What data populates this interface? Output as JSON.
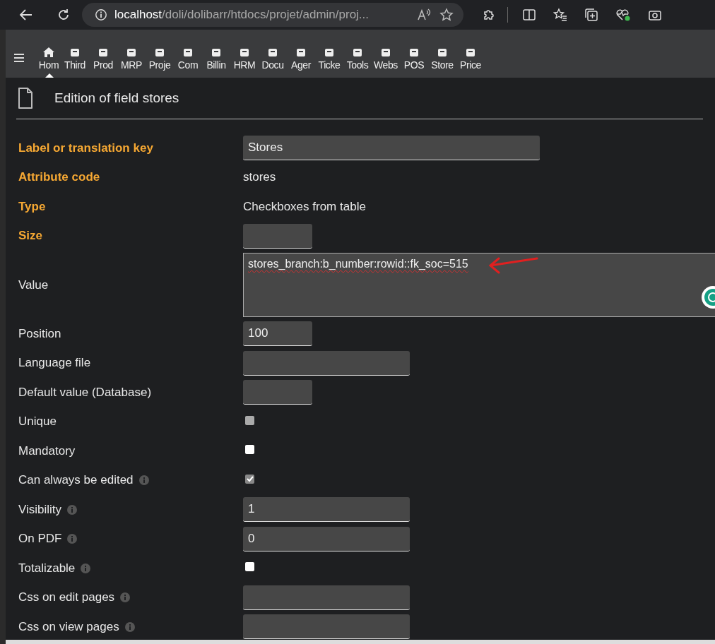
{
  "browser": {
    "url_host": "localhost",
    "url_path": "/doli/dolibarr/htdocs/projet/admin/proj..."
  },
  "menu": [
    {
      "label": "Hom",
      "selected": true
    },
    {
      "label": "Third",
      "selected": false
    },
    {
      "label": "Prod",
      "selected": false
    },
    {
      "label": "MRP",
      "selected": false
    },
    {
      "label": "Proje",
      "selected": false
    },
    {
      "label": "Com",
      "selected": false
    },
    {
      "label": "Billin",
      "selected": false
    },
    {
      "label": "HRM",
      "selected": false
    },
    {
      "label": "Docu",
      "selected": false
    },
    {
      "label": "Ager",
      "selected": false
    },
    {
      "label": "Ticke",
      "selected": false
    },
    {
      "label": "Tools",
      "selected": false
    },
    {
      "label": "Webs",
      "selected": false
    },
    {
      "label": "POS",
      "selected": false
    },
    {
      "label": "Store",
      "selected": false
    },
    {
      "label": "Price",
      "selected": false
    }
  ],
  "page_title": "Edition of field stores",
  "fields": [
    {
      "label": "Label or translation key",
      "required": true,
      "kind": "wideinput",
      "value": "Stores"
    },
    {
      "label": "Attribute code",
      "required": true,
      "kind": "text",
      "value": "stores"
    },
    {
      "label": "Type",
      "required": true,
      "kind": "text",
      "value": "Checkboxes from table"
    },
    {
      "label": "Size",
      "required": true,
      "kind": "shortinput"
    },
    {
      "label": "Value",
      "required": false,
      "kind": "textarea",
      "value": "stores_branch:b_number:rowid::fk_soc=515"
    },
    {
      "label": "Position",
      "required": false,
      "kind": "shortinput",
      "value": "100"
    },
    {
      "label": "Language file",
      "required": false,
      "kind": "longinput"
    },
    {
      "label": "Default value (Database)",
      "required": false,
      "kind": "shortinput"
    },
    {
      "label": "Unique",
      "required": false,
      "kind": "checkbox",
      "checked": false,
      "disabled": true
    },
    {
      "label": "Mandatory",
      "required": false,
      "kind": "checkbox",
      "checked": false,
      "disabled": false
    },
    {
      "label": "Can always be edited",
      "required": false,
      "info": true,
      "kind": "checkbox",
      "checked": true,
      "disabled": true
    },
    {
      "label": "Visibility",
      "required": false,
      "info": true,
      "kind": "longinput",
      "value": "1"
    },
    {
      "label": "On PDF",
      "required": false,
      "info": true,
      "kind": "longinput",
      "value": "0"
    },
    {
      "label": "Totalizable",
      "required": false,
      "info": true,
      "kind": "checkbox",
      "checked": false,
      "disabled": false
    },
    {
      "label": "Css on edit pages",
      "required": false,
      "info": true,
      "kind": "longinput"
    },
    {
      "label": "Css on view pages",
      "required": false,
      "info": true,
      "kind": "longinput"
    }
  ]
}
